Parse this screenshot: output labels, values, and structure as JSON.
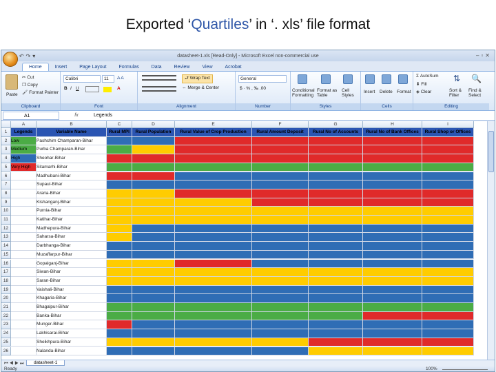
{
  "slide_title": {
    "before": "Exported  ‘",
    "highlight": "Quartiles",
    "after": "’ in ‘. xls’ file format"
  },
  "window": {
    "title": "datasheet-1.xls  [Read-Only] - Microsoft Excel non-commercial use"
  },
  "ribbon_tabs": [
    "Home",
    "Insert",
    "Page Layout",
    "Formulas",
    "Data",
    "Review",
    "View",
    "Acrobat"
  ],
  "ribbon": {
    "clipboard": {
      "paste": "Paste",
      "cut": "Cut",
      "copy": "Copy",
      "format_painter": "Format Painter",
      "label": "Clipboard"
    },
    "font": {
      "name": "Calibri",
      "size": "11",
      "label": "Font"
    },
    "alignment": {
      "wrap": "Wrap Text",
      "merge": "Merge & Center",
      "label": "Alignment"
    },
    "number": {
      "format": "General",
      "label": "Number"
    },
    "styles": {
      "conditional": "Conditional Formatting",
      "format_table": "Format as Table",
      "cell_styles": "Cell Styles",
      "label": "Styles"
    },
    "cells": {
      "insert": "Insert",
      "delete": "Delete",
      "format": "Format",
      "label": "Cells"
    },
    "editing": {
      "autosum": "AutoSum",
      "fill": "Fill",
      "clear": "Clear",
      "sort": "Sort & Filter",
      "find": "Find & Select",
      "label": "Editing"
    }
  },
  "formula": {
    "namebox": "A1",
    "fx": "fx",
    "value": "Legends"
  },
  "columns": [
    "A",
    "B",
    "C",
    "D",
    "E",
    "F",
    "G",
    "H",
    "I"
  ],
  "header_row": [
    "Legends",
    "Variable Name",
    "Rural MPI",
    "Rural Population",
    "Rural Value of Crop Production",
    "Rural Amount Deposit",
    "Rural No of Accounts",
    "Rural No of Bank Offices",
    "Rural Shop or Offices"
  ],
  "legend": [
    {
      "label": "Low",
      "color": "#4bac45"
    },
    {
      "label": "Medium",
      "color": "#4bac45"
    },
    {
      "label": "High",
      "color": "#2f6db5"
    },
    {
      "label": "Very High",
      "color": "#e02a2a"
    }
  ],
  "colors": {
    "G": "#4bac45",
    "Y": "#ffcc00",
    "R": "#e02a2a",
    "B": "#2f6db5",
    "header": "#2b55b2"
  },
  "districts": [
    "Pashchim Champaran-Bihar",
    "Purba Champaran-Bihar",
    "Sheohar-Bihar",
    "Sitamarhi-Bihar",
    "Madhubani-Bihar",
    "Supaul-Bihar",
    "Araria-Bihar",
    "Kishanganj-Bihar",
    "Purnia-Bihar",
    "Katihar-Bihar",
    "Madhepura-Bihar",
    "Saharsa-Bihar",
    "Darbhanga-Bihar",
    "Muzaffarpur-Bihar",
    "Gopalganj-Bihar",
    "Siwan-Bihar",
    "Saran-Bihar",
    "Vaishali-Bihar",
    "Khagaria-Bihar",
    "Bhagalpur-Bihar",
    "Banka-Bihar",
    "Munger-Bihar",
    "Lakhisarai-Bihar",
    "Sheikhpura-Bihar",
    "Nalanda-Bihar"
  ],
  "grid_colors": [
    "BBRRRRR",
    "GYRRRRR",
    "RRRRRRR",
    "GGGGGGG",
    "RRBBBBB",
    "BBBBBBB",
    "YYRRRRR",
    "YYYRRRR",
    "YYYYYYY",
    "YYYYYYY",
    "YBBBBBB",
    "YBBBBBB",
    "BBBBBBB",
    "BBBBBBB",
    "YYRBBBB",
    "YYYYYYY",
    "YYYYYYY",
    "BBBBBBB",
    "BBBBBBB",
    "GGGGGGG",
    "GGGGGRR",
    "RBBBBBB",
    "BBBBBBB",
    "YYYYRRR",
    "BBBBYYY"
  ],
  "sheet_tab": "datasheet-1",
  "status": {
    "ready": "Ready",
    "zoom": "100%"
  }
}
